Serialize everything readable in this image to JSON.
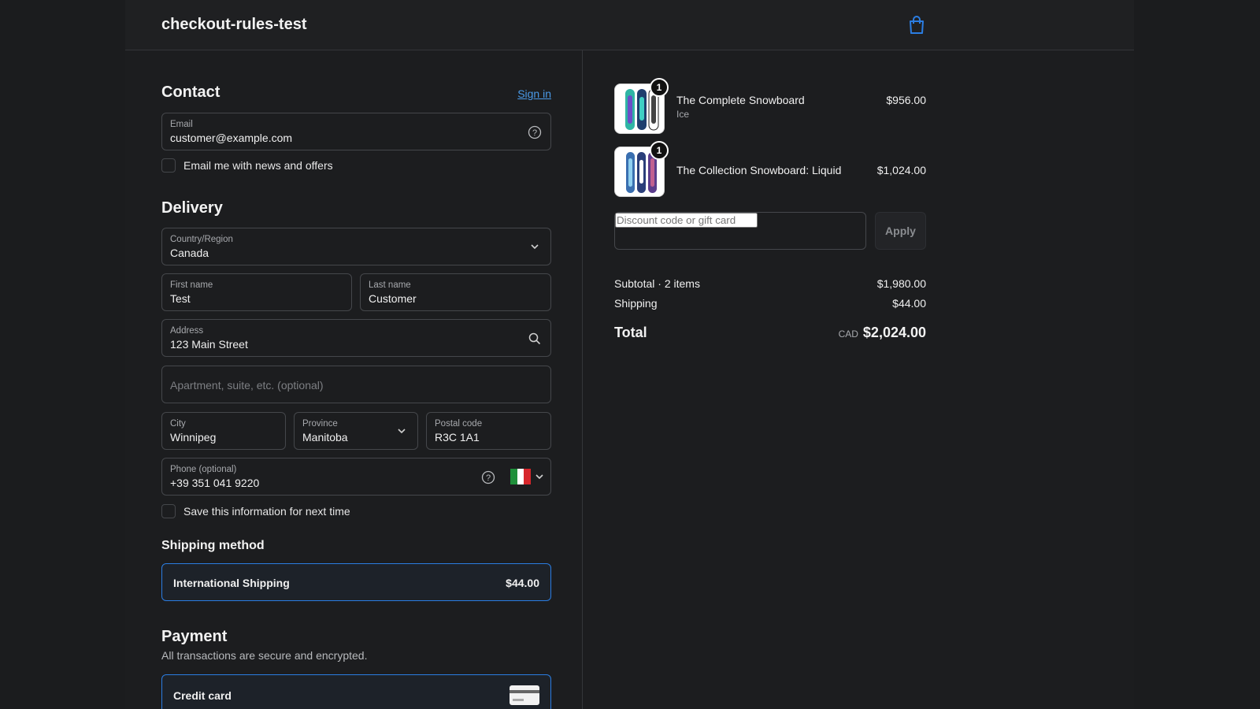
{
  "header": {
    "shop_name": "checkout-rules-test",
    "cart_icon": "shopping-bag-icon",
    "accent": "#2b7de2"
  },
  "contact": {
    "title": "Contact",
    "sign_in": "Sign in",
    "email_label": "Email",
    "email_value": "customer@example.com",
    "newsletter_label": "Email me with news and offers"
  },
  "delivery": {
    "title": "Delivery",
    "country_label": "Country/Region",
    "country_value": "Canada",
    "first_name_label": "First name",
    "first_name_value": "Test",
    "last_name_label": "Last name",
    "last_name_value": "Customer",
    "address_label": "Address",
    "address_value": "123 Main Street",
    "apartment_placeholder": "Apartment, suite, etc. (optional)",
    "city_label": "City",
    "city_value": "Winnipeg",
    "province_label": "Province",
    "province_value": "Manitoba",
    "postal_label": "Postal code",
    "postal_value": "R3C 1A1",
    "phone_label": "Phone (optional)",
    "phone_value": "+39 351 041 9220",
    "save_info_label": "Save this information for next time"
  },
  "shipping_method": {
    "title": "Shipping method",
    "option_name": "International Shipping",
    "option_price": "$44.00"
  },
  "payment": {
    "title": "Payment",
    "subtitle": "All transactions are secure and encrypted.",
    "method": "Credit card"
  },
  "order": {
    "items": [
      {
        "title": "The Complete Snowboard",
        "variant": "Ice",
        "price": "$956.00",
        "quantity": "1"
      },
      {
        "title": "The Collection Snowboard: Liquid",
        "variant": "",
        "price": "$1,024.00",
        "quantity": "1"
      }
    ],
    "discount_placeholder": "Discount code or gift card",
    "apply_label": "Apply",
    "subtotal_label": "Subtotal · 2 items",
    "subtotal_value": "$1,980.00",
    "shipping_label": "Shipping",
    "shipping_value": "$44.00",
    "total_label": "Total",
    "currency": "CAD",
    "total_value": "$2,024.00"
  }
}
